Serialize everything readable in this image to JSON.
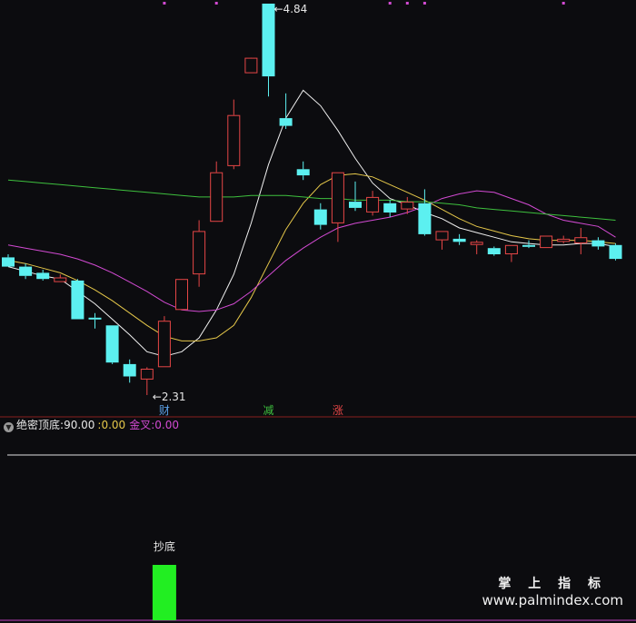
{
  "chart_data": {
    "type": "candlestick",
    "candles": [
      {
        "o": 3.2,
        "h": 3.22,
        "l": 3.14,
        "c": 3.14
      },
      {
        "o": 3.14,
        "h": 3.16,
        "l": 3.06,
        "c": 3.08
      },
      {
        "o": 3.1,
        "h": 3.12,
        "l": 3.05,
        "c": 3.06
      },
      {
        "o": 3.04,
        "h": 3.09,
        "l": 3.04,
        "c": 3.07
      },
      {
        "o": 3.05,
        "h": 3.06,
        "l": 2.8,
        "c": 2.8
      },
      {
        "o": 2.81,
        "h": 2.84,
        "l": 2.74,
        "c": 2.8
      },
      {
        "o": 2.76,
        "h": 2.76,
        "l": 2.51,
        "c": 2.52
      },
      {
        "o": 2.51,
        "h": 2.54,
        "l": 2.39,
        "c": 2.43
      },
      {
        "o": 2.41,
        "h": 2.49,
        "l": 2.31,
        "c": 2.48
      },
      {
        "o": 2.49,
        "h": 2.82,
        "l": 2.49,
        "c": 2.79
      },
      {
        "o": 2.86,
        "h": 3.06,
        "l": 2.86,
        "c": 3.06
      },
      {
        "o": 3.09,
        "h": 3.44,
        "l": 3.01,
        "c": 3.37
      },
      {
        "o": 3.43,
        "h": 3.82,
        "l": 3.43,
        "c": 3.75
      },
      {
        "o": 3.79,
        "h": 4.22,
        "l": 3.77,
        "c": 4.12
      },
      {
        "o": 4.39,
        "h": 4.48,
        "l": 4.39,
        "c": 4.49
      },
      {
        "o": 4.84,
        "h": 4.84,
        "l": 4.24,
        "c": 4.37
      },
      {
        "o": 4.1,
        "h": 4.26,
        "l": 4.03,
        "c": 4.05
      },
      {
        "o": 3.77,
        "h": 3.82,
        "l": 3.7,
        "c": 3.73
      },
      {
        "o": 3.51,
        "h": 3.55,
        "l": 3.38,
        "c": 3.41
      },
      {
        "o": 3.42,
        "h": 3.75,
        "l": 3.3,
        "c": 3.75
      },
      {
        "o": 3.56,
        "h": 3.69,
        "l": 3.5,
        "c": 3.52
      },
      {
        "o": 3.49,
        "h": 3.63,
        "l": 3.47,
        "c": 3.59
      },
      {
        "o": 3.55,
        "h": 3.57,
        "l": 3.46,
        "c": 3.49
      },
      {
        "o": 3.51,
        "h": 3.59,
        "l": 3.48,
        "c": 3.56
      },
      {
        "o": 3.55,
        "h": 3.64,
        "l": 3.34,
        "c": 3.35
      },
      {
        "o": 3.31,
        "h": 3.37,
        "l": 3.25,
        "c": 3.37
      },
      {
        "o": 3.32,
        "h": 3.35,
        "l": 3.28,
        "c": 3.3
      },
      {
        "o": 3.28,
        "h": 3.31,
        "l": 3.22,
        "c": 3.3
      },
      {
        "o": 3.26,
        "h": 3.27,
        "l": 3.21,
        "c": 3.22
      },
      {
        "o": 3.22,
        "h": 3.28,
        "l": 3.17,
        "c": 3.28
      },
      {
        "o": 3.28,
        "h": 3.31,
        "l": 3.26,
        "c": 3.27
      },
      {
        "o": 3.26,
        "h": 3.34,
        "l": 3.26,
        "c": 3.34
      },
      {
        "o": 3.3,
        "h": 3.34,
        "l": 3.29,
        "c": 3.32
      },
      {
        "o": 3.29,
        "h": 3.39,
        "l": 3.22,
        "c": 3.33
      },
      {
        "o": 3.31,
        "h": 3.33,
        "l": 3.25,
        "c": 3.27
      },
      {
        "o": 3.28,
        "h": 3.29,
        "l": 3.18,
        "c": 3.19
      }
    ],
    "ma_lines": [
      {
        "color": "#f0f0f0",
        "values": [
          3.14,
          3.11,
          3.08,
          3.06,
          2.98,
          2.9,
          2.8,
          2.7,
          2.59,
          2.56,
          2.59,
          2.68,
          2.86,
          3.09,
          3.42,
          3.8,
          4.1,
          4.28,
          4.18,
          4.02,
          3.84,
          3.68,
          3.58,
          3.54,
          3.49,
          3.45,
          3.39,
          3.36,
          3.33,
          3.3,
          3.29,
          3.28,
          3.28,
          3.29,
          3.29,
          3.27
        ]
      },
      {
        "color": "#e6c84a",
        "values": [
          3.18,
          3.16,
          3.13,
          3.1,
          3.05,
          2.99,
          2.92,
          2.84,
          2.76,
          2.69,
          2.66,
          2.66,
          2.68,
          2.76,
          2.94,
          3.16,
          3.38,
          3.55,
          3.67,
          3.73,
          3.74,
          3.72,
          3.67,
          3.62,
          3.57,
          3.51,
          3.45,
          3.4,
          3.37,
          3.34,
          3.32,
          3.31,
          3.31,
          3.31,
          3.3,
          3.29
        ]
      },
      {
        "color": "#d24ad2",
        "values": [
          3.28,
          3.26,
          3.24,
          3.22,
          3.19,
          3.15,
          3.1,
          3.04,
          2.98,
          2.91,
          2.86,
          2.85,
          2.86,
          2.9,
          2.98,
          3.08,
          3.18,
          3.26,
          3.33,
          3.39,
          3.42,
          3.44,
          3.46,
          3.49,
          3.53,
          3.58,
          3.61,
          3.63,
          3.62,
          3.58,
          3.54,
          3.48,
          3.44,
          3.42,
          3.4,
          3.33
        ]
      },
      {
        "color": "#3ec03e",
        "values": [
          3.7,
          3.69,
          3.68,
          3.67,
          3.66,
          3.65,
          3.64,
          3.63,
          3.62,
          3.61,
          3.6,
          3.59,
          3.59,
          3.59,
          3.6,
          3.6,
          3.6,
          3.59,
          3.58,
          3.58,
          3.57,
          3.57,
          3.57,
          3.56,
          3.56,
          3.55,
          3.54,
          3.52,
          3.51,
          3.5,
          3.49,
          3.48,
          3.47,
          3.46,
          3.45,
          3.44
        ]
      }
    ],
    "ylim": [
      2.2,
      5.0
    ],
    "annotations": [
      {
        "text": "4.84",
        "index": 15,
        "price": 4.84,
        "kind": "high"
      },
      {
        "text": "2.31",
        "index": 8,
        "price": 2.31,
        "kind": "low"
      }
    ],
    "markers": [
      {
        "text": "财",
        "index": 9,
        "color": "#5aa0e6"
      },
      {
        "text": "减",
        "index": 15,
        "color": "#3ec03e"
      },
      {
        "text": "涨",
        "index": 19,
        "color": "#e64646"
      }
    ],
    "top_dots": [
      9,
      12,
      22,
      23,
      24,
      32
    ],
    "indicator": {
      "name": "绝密顶底",
      "value1": "90.00",
      "separator": ":",
      "value2": "0.00",
      "name3": "金叉",
      "value3": "0.00",
      "signal_label": "抄底",
      "signal_index": 9,
      "signal_color": "#22ee22",
      "colors": {
        "name": "#e6e6e6",
        "value2": "#e6c84a",
        "name3": "#d24ad2"
      }
    },
    "colors": {
      "up": "#e64646",
      "down": "#5cf0f0",
      "background": "#0c0c0f",
      "divider": "#8a1f1f",
      "baseline": "#e0e0e0"
    }
  },
  "watermark": {
    "cn": "掌 上 指 标",
    "url": "www.palmindex.com"
  }
}
